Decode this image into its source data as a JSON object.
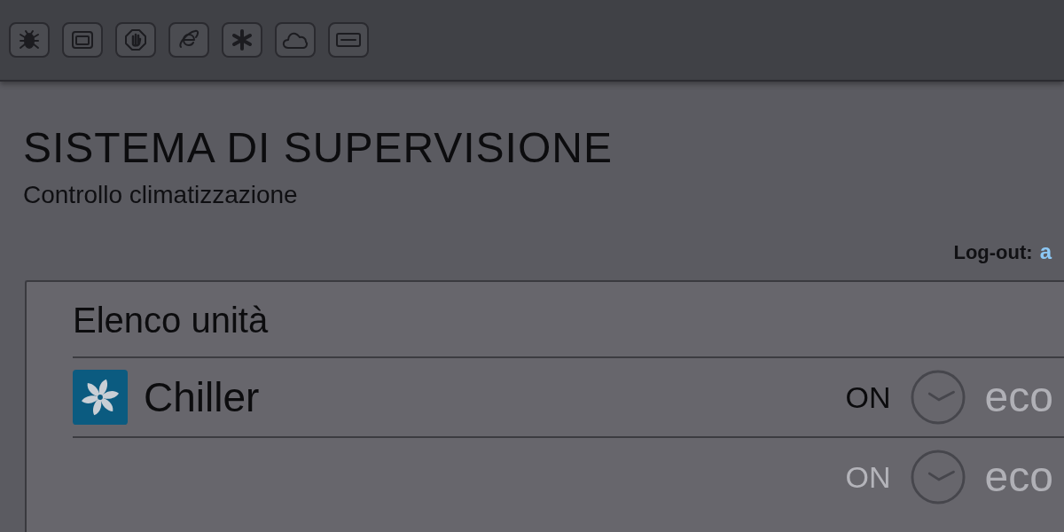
{
  "header": {
    "title": "SISTEMA DI SUPERVISIONE",
    "subtitle": "Controllo climatizzazione"
  },
  "session": {
    "label": "Log-out:",
    "user": "a"
  },
  "units_panel": {
    "title": "Elenco unità",
    "units": [
      {
        "kind": "chiller",
        "name": "Chiller",
        "power": {
          "label": "ON",
          "on": true
        },
        "eco": {
          "label": "eco",
          "on": false
        }
      },
      {
        "power": {
          "label": "ON",
          "on": false
        },
        "eco": {
          "label": "eco",
          "on": false
        }
      }
    ]
  }
}
